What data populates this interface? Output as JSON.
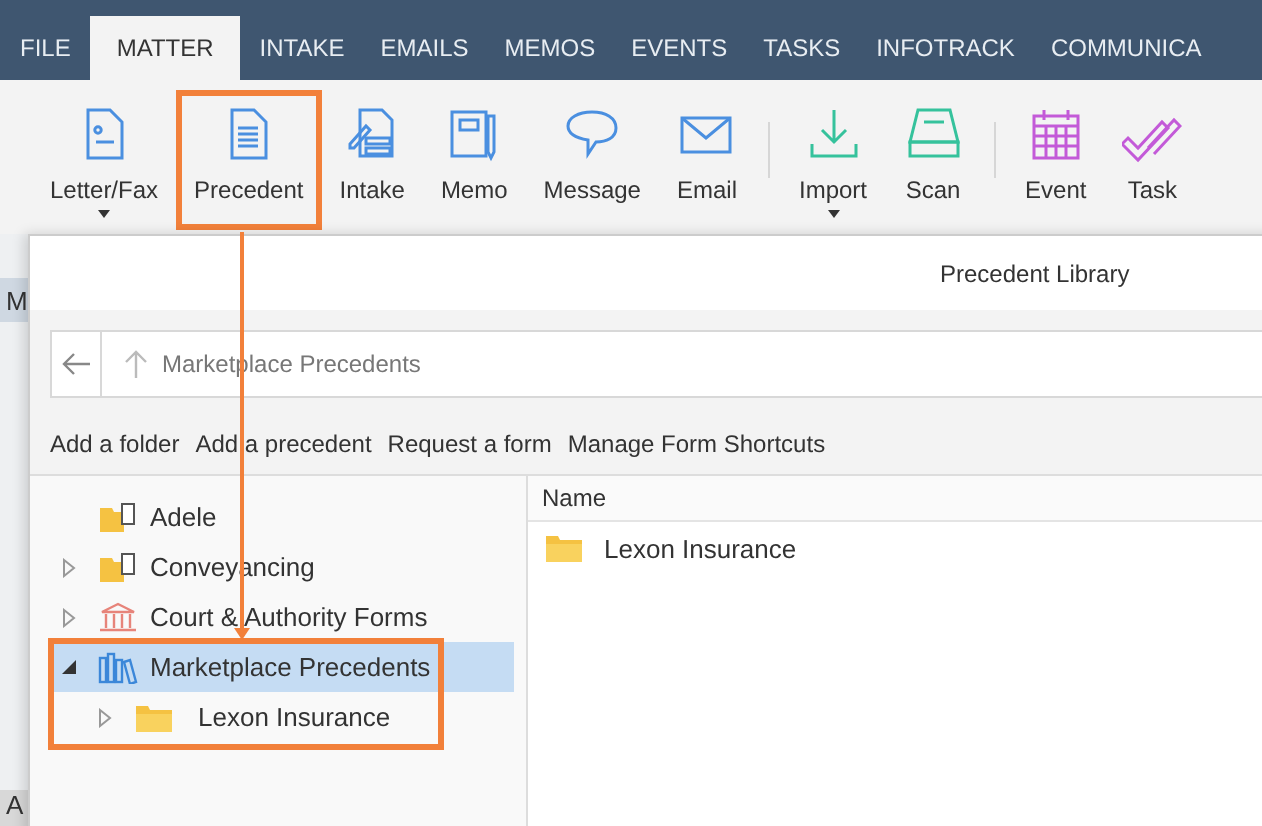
{
  "tabs": [
    {
      "label": "FILE",
      "selected": false
    },
    {
      "label": "MATTER",
      "selected": true
    },
    {
      "label": "INTAKE",
      "selected": false
    },
    {
      "label": "EMAILS",
      "selected": false
    },
    {
      "label": "MEMOS",
      "selected": false
    },
    {
      "label": "EVENTS",
      "selected": false
    },
    {
      "label": "TASKS",
      "selected": false
    },
    {
      "label": "INFOTRACK",
      "selected": false
    },
    {
      "label": "COMMUNICA",
      "selected": false
    }
  ],
  "ribbon": {
    "groups": [
      {
        "buttons": [
          {
            "kind": "letter",
            "label": "Letter/Fax",
            "dropdown": true,
            "highlighted": false
          },
          {
            "kind": "precedent",
            "label": "Precedent",
            "dropdown": false,
            "highlighted": true
          },
          {
            "kind": "intake",
            "label": "Intake",
            "dropdown": false,
            "highlighted": false
          },
          {
            "kind": "memo",
            "label": "Memo",
            "dropdown": false,
            "highlighted": false
          },
          {
            "kind": "message",
            "label": "Message",
            "dropdown": false,
            "highlighted": false
          },
          {
            "kind": "email",
            "label": "Email",
            "dropdown": false,
            "highlighted": false
          }
        ]
      },
      {
        "buttons": [
          {
            "kind": "import",
            "label": "Import",
            "dropdown": true,
            "highlighted": false
          },
          {
            "kind": "scan",
            "label": "Scan",
            "dropdown": false,
            "highlighted": false
          }
        ]
      },
      {
        "buttons": [
          {
            "kind": "event",
            "label": "Event",
            "dropdown": false,
            "highlighted": false
          },
          {
            "kind": "task",
            "label": "Task",
            "dropdown": false,
            "highlighted": false
          }
        ]
      }
    ]
  },
  "background_texts": [
    "M",
    "A"
  ],
  "dialog": {
    "title": "Precedent Library",
    "location": "Marketplace Precedents",
    "actions": [
      "Add a folder",
      "Add a precedent",
      "Request a form",
      "Manage Form Shortcuts"
    ],
    "tree_highlighted": true,
    "tree": [
      {
        "kind": "document-folder",
        "label": "Adele",
        "expandable": false,
        "selected": false
      },
      {
        "kind": "document-folder",
        "label": "Conveyancing",
        "expandable": true,
        "expanded": false,
        "selected": false
      },
      {
        "kind": "building",
        "label": "Court & Authority Forms",
        "expandable": true,
        "expanded": false,
        "selected": false
      },
      {
        "kind": "library",
        "label": "Marketplace Precedents",
        "expandable": true,
        "expanded": true,
        "selected": true,
        "children": [
          {
            "kind": "folder",
            "label": "Lexon Insurance",
            "expandable": true,
            "expanded": false,
            "selected": false
          }
        ]
      }
    ],
    "list": {
      "columns": [
        "Name"
      ],
      "rows": [
        {
          "name": "Lexon Insurance"
        }
      ]
    }
  }
}
